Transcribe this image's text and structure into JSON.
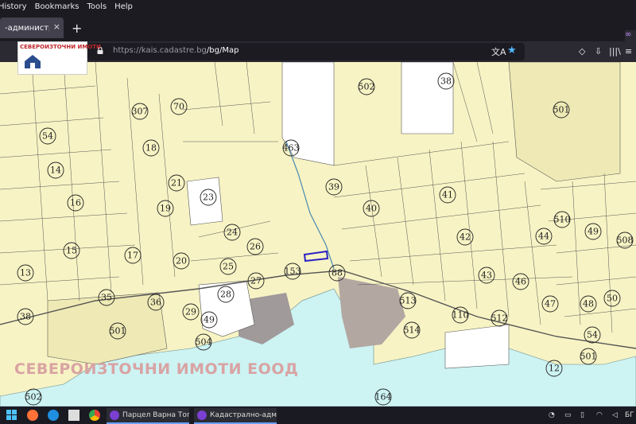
{
  "menu": {
    "items": [
      "History",
      "Bookmarks",
      "Tools",
      "Help"
    ]
  },
  "tab": {
    "title": "-административ",
    "close": "×",
    "new_tab": "+"
  },
  "navbar": {
    "url_host": "https://kais.cadastre.bg",
    "url_path": "/bg/Map",
    "translate_icon": "translate-icon",
    "bookmark_icon": "star-icon"
  },
  "logo": {
    "text": "СЕВЕРОИЗТОЧНИ ИМОТИ"
  },
  "map": {
    "watermark": "СЕВЕРОИЗТОЧНИ ИМОТИ ЕООД",
    "parcel_labels": [
      "307",
      "70",
      "502",
      "38",
      "501",
      "54",
      "18",
      "463",
      "14",
      "21",
      "23",
      "39",
      "41",
      "16",
      "19",
      "40",
      "510",
      "24",
      "26",
      "44",
      "49",
      "508",
      "15",
      "17",
      "20",
      "25",
      "42",
      "13",
      "153",
      "88",
      "43",
      "46",
      "27",
      "35",
      "36",
      "28",
      "513",
      "110",
      "512",
      "47",
      "48",
      "50",
      "38",
      "501",
      "29",
      "49",
      "514",
      "504",
      "54",
      "501",
      "12",
      "502",
      "164"
    ]
  },
  "taskbar": {
    "tasks": [
      "Парцел Варна Тополи...",
      "Кадастрално-админ..."
    ],
    "tray_lang": "БГ"
  },
  "colors": {
    "map_bg": "#f7f3c4",
    "sea": "#cdf3f3",
    "industrial": "#a09a9a",
    "highlight": "#2b21c4"
  }
}
